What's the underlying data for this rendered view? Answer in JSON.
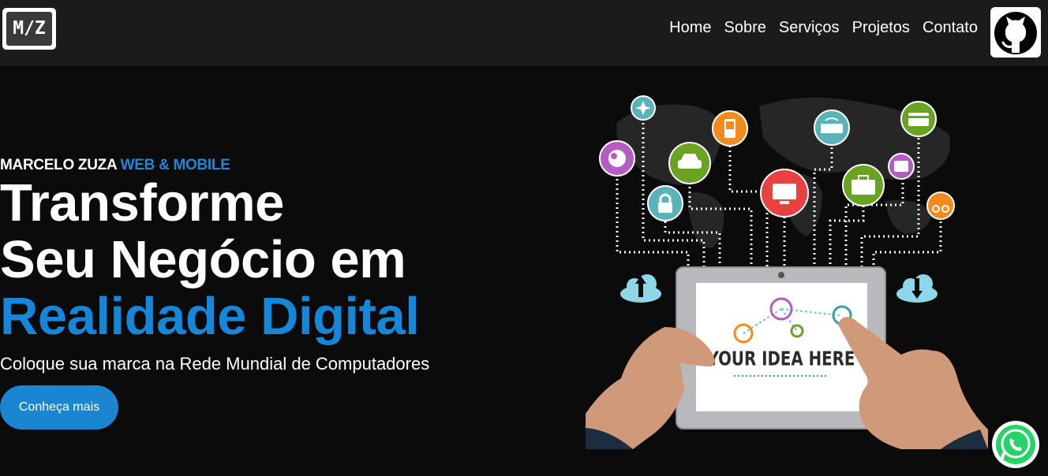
{
  "nav": {
    "logo_text": "M/Z",
    "items": [
      "Home",
      "Sobre",
      "Serviços",
      "Projetos",
      "Contato"
    ]
  },
  "hero": {
    "eyebrow_name": "MARCELO ZUZA",
    "eyebrow_accent": "WEB & MOBILE",
    "headline_line1": "Transforme",
    "headline_line2": "Seu Negócio em",
    "headline_line3": "Realidade Digital",
    "subtitle": "Coloque sua marca na Rede Mundial de Computadores",
    "cta_label": "Conheça mais"
  },
  "illustration": {
    "screen_text": "YOUR IDEA HERE"
  },
  "icons": {
    "github": "github-icon",
    "whatsapp": "whatsapp-icon"
  },
  "colors": {
    "accent": "#1686d9",
    "nav_bg": "#1b1b1b",
    "page_bg": "#0b0b0b",
    "whatsapp": "#25d366"
  }
}
